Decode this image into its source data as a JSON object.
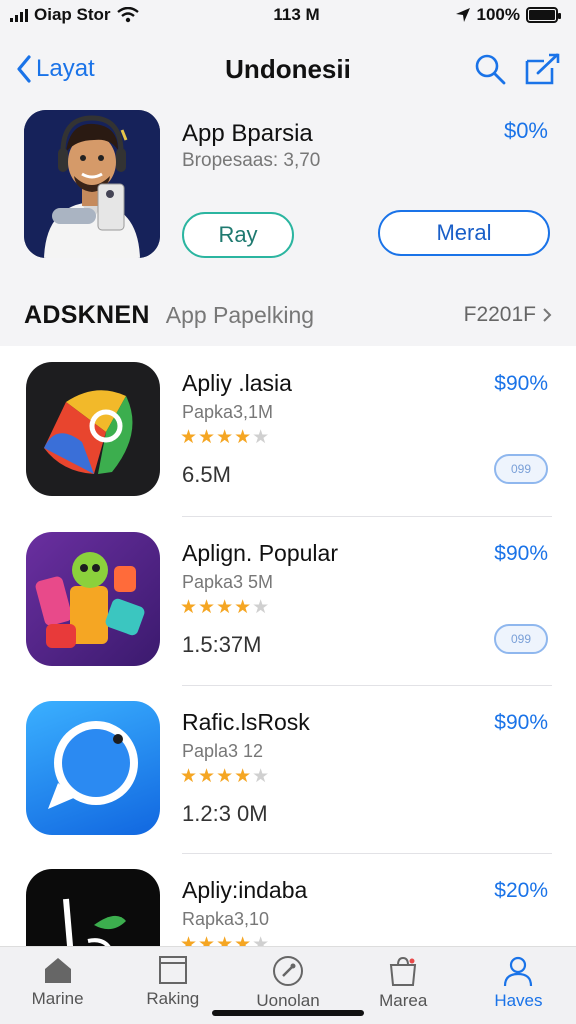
{
  "status": {
    "carrier": "Oiap Stor",
    "time": "113 M",
    "battery": "100%"
  },
  "nav": {
    "back_label": "Layat",
    "title": "Undonesii"
  },
  "featured": {
    "title": "App Bparsia",
    "subtitle": "Bropesaas: 3,70",
    "price": "$0%",
    "play_label": "Ray",
    "more_label": "Meral"
  },
  "section": {
    "title": "ADSKNEN",
    "subtitle": "App Papelking",
    "link": "F2201F"
  },
  "apps": [
    {
      "name": "Apliy .lasia",
      "publisher": "Papka3,1M",
      "rating": 4.5,
      "stars": "★★★★",
      "half_star": "★",
      "size": "6.5M",
      "price": "$90%",
      "badge": "099"
    },
    {
      "name": "Aplign. Popular",
      "publisher": "Papka3 5M",
      "rating": 4.5,
      "stars": "★★★★",
      "half_star": "★",
      "size": "1.5:37M",
      "price": "$90%",
      "badge": "099"
    },
    {
      "name": "Rafic.lsRosk",
      "publisher": "Papla3 12",
      "rating": 4.5,
      "stars": "★★★★",
      "half_star": "★",
      "size": "1.2:3 0M",
      "price": "$90%"
    },
    {
      "name": "Apliy:indaba",
      "publisher": "Rapka3,10",
      "rating": 4.5,
      "stars": "★★★★",
      "half_star": "★",
      "price": "$20%"
    }
  ],
  "tabs": [
    {
      "label": "Marine",
      "icon": "home-icon"
    },
    {
      "label": "Raking",
      "icon": "ranking-icon"
    },
    {
      "label": "Uonolan",
      "icon": "explore-icon"
    },
    {
      "label": "Marea",
      "icon": "bag-icon"
    },
    {
      "label": "Haves",
      "icon": "person-icon",
      "active": true
    }
  ],
  "colors": {
    "accent": "#1a73e8",
    "star": "#f5a623",
    "play_border": "#2bb5a0"
  }
}
